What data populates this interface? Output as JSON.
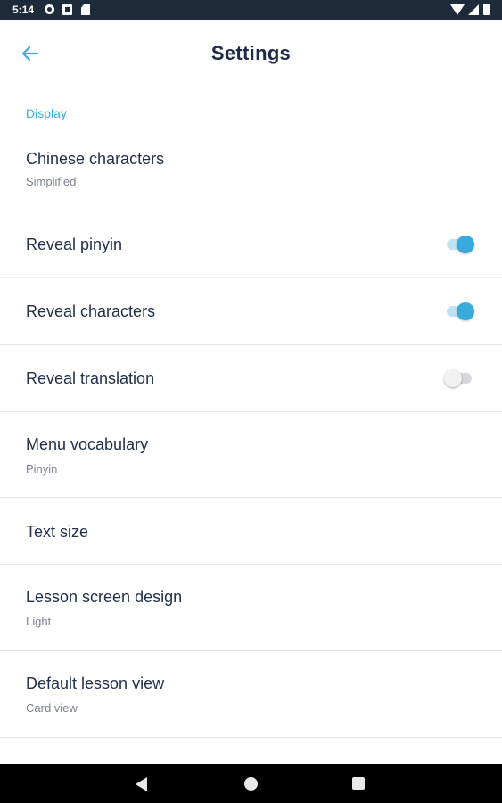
{
  "status_bar": {
    "time": "5:14",
    "icons": [
      "gear-icon",
      "notification-a-icon",
      "sd-card-icon",
      "wifi-icon",
      "signal-icon",
      "battery-icon"
    ]
  },
  "app_bar": {
    "title": "Settings",
    "back_icon": "arrow-left-icon",
    "accent_color": "#3ab0de"
  },
  "display_section": {
    "header": "Display",
    "items": [
      {
        "title": "Chinese characters",
        "subtitle": "Simplified"
      },
      {
        "title": "Reveal pinyin",
        "toggle": true
      },
      {
        "title": "Reveal characters",
        "toggle": true
      },
      {
        "title": "Reveal translation",
        "toggle": false
      },
      {
        "title": "Menu vocabulary",
        "subtitle": "Pinyin"
      },
      {
        "title": "Text size"
      },
      {
        "title": "Lesson screen design",
        "subtitle": "Light"
      },
      {
        "title": "Default lesson view",
        "subtitle": "Card view"
      }
    ]
  },
  "nav_bar": {
    "icons": [
      "nav-back-icon",
      "nav-home-icon",
      "nav-recents-icon"
    ]
  }
}
